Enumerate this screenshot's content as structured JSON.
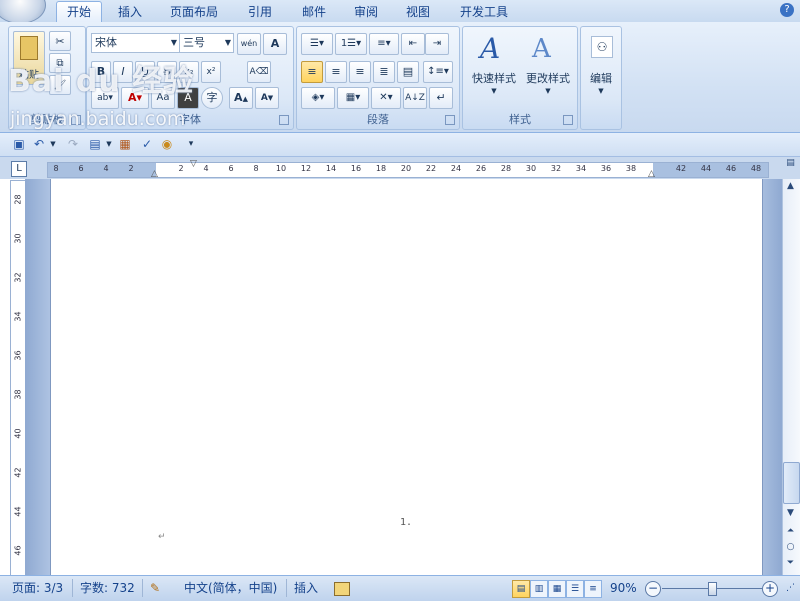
{
  "ribbon_tabs": [
    {
      "label": "开始",
      "active": true
    },
    {
      "label": "插入"
    },
    {
      "label": "页面布局"
    },
    {
      "label": "引用"
    },
    {
      "label": "邮件"
    },
    {
      "label": "审阅"
    },
    {
      "label": "视图"
    },
    {
      "label": "开发工具"
    }
  ],
  "help_label": "?",
  "clipboard": {
    "paste_label": "粘贴",
    "group_label": "剪贴板"
  },
  "font": {
    "font_name": "宋体",
    "font_size": "三号",
    "phonetic_label": "wén",
    "bold": "B",
    "italic": "I",
    "underline": "U",
    "grow": "A",
    "shrink": "A",
    "group_label": "字体"
  },
  "paragraph": {
    "group_label": "段落"
  },
  "styles": {
    "quick_styles_label": "快速样式",
    "change_styles_label": "更改样式",
    "group_label": "样式"
  },
  "editing": {
    "label": "编辑"
  },
  "watermark": {
    "logo": "Bai du 经验",
    "url": "jingyan.baidu.com"
  },
  "ruler": {
    "h_ticks": [
      "8",
      "6",
      "4",
      "2",
      "2",
      "4",
      "6",
      "8",
      "10",
      "12",
      "14",
      "16",
      "18",
      "20",
      "22",
      "24",
      "26",
      "28",
      "30",
      "32",
      "34",
      "36",
      "38",
      "42",
      "44",
      "46",
      "48"
    ],
    "v_ticks": [
      "28",
      "30",
      "32",
      "34",
      "36",
      "38",
      "40",
      "42",
      "44",
      "46"
    ],
    "corner": "L"
  },
  "document": {
    "page_number_text": "1.",
    "para_mark": "↵"
  },
  "statusbar": {
    "page": "页面: 3/3",
    "words": "字数: 732",
    "language": "中文(简体，中国)",
    "mode": "插入",
    "zoom": "90%",
    "zoom_level": 0.5
  }
}
